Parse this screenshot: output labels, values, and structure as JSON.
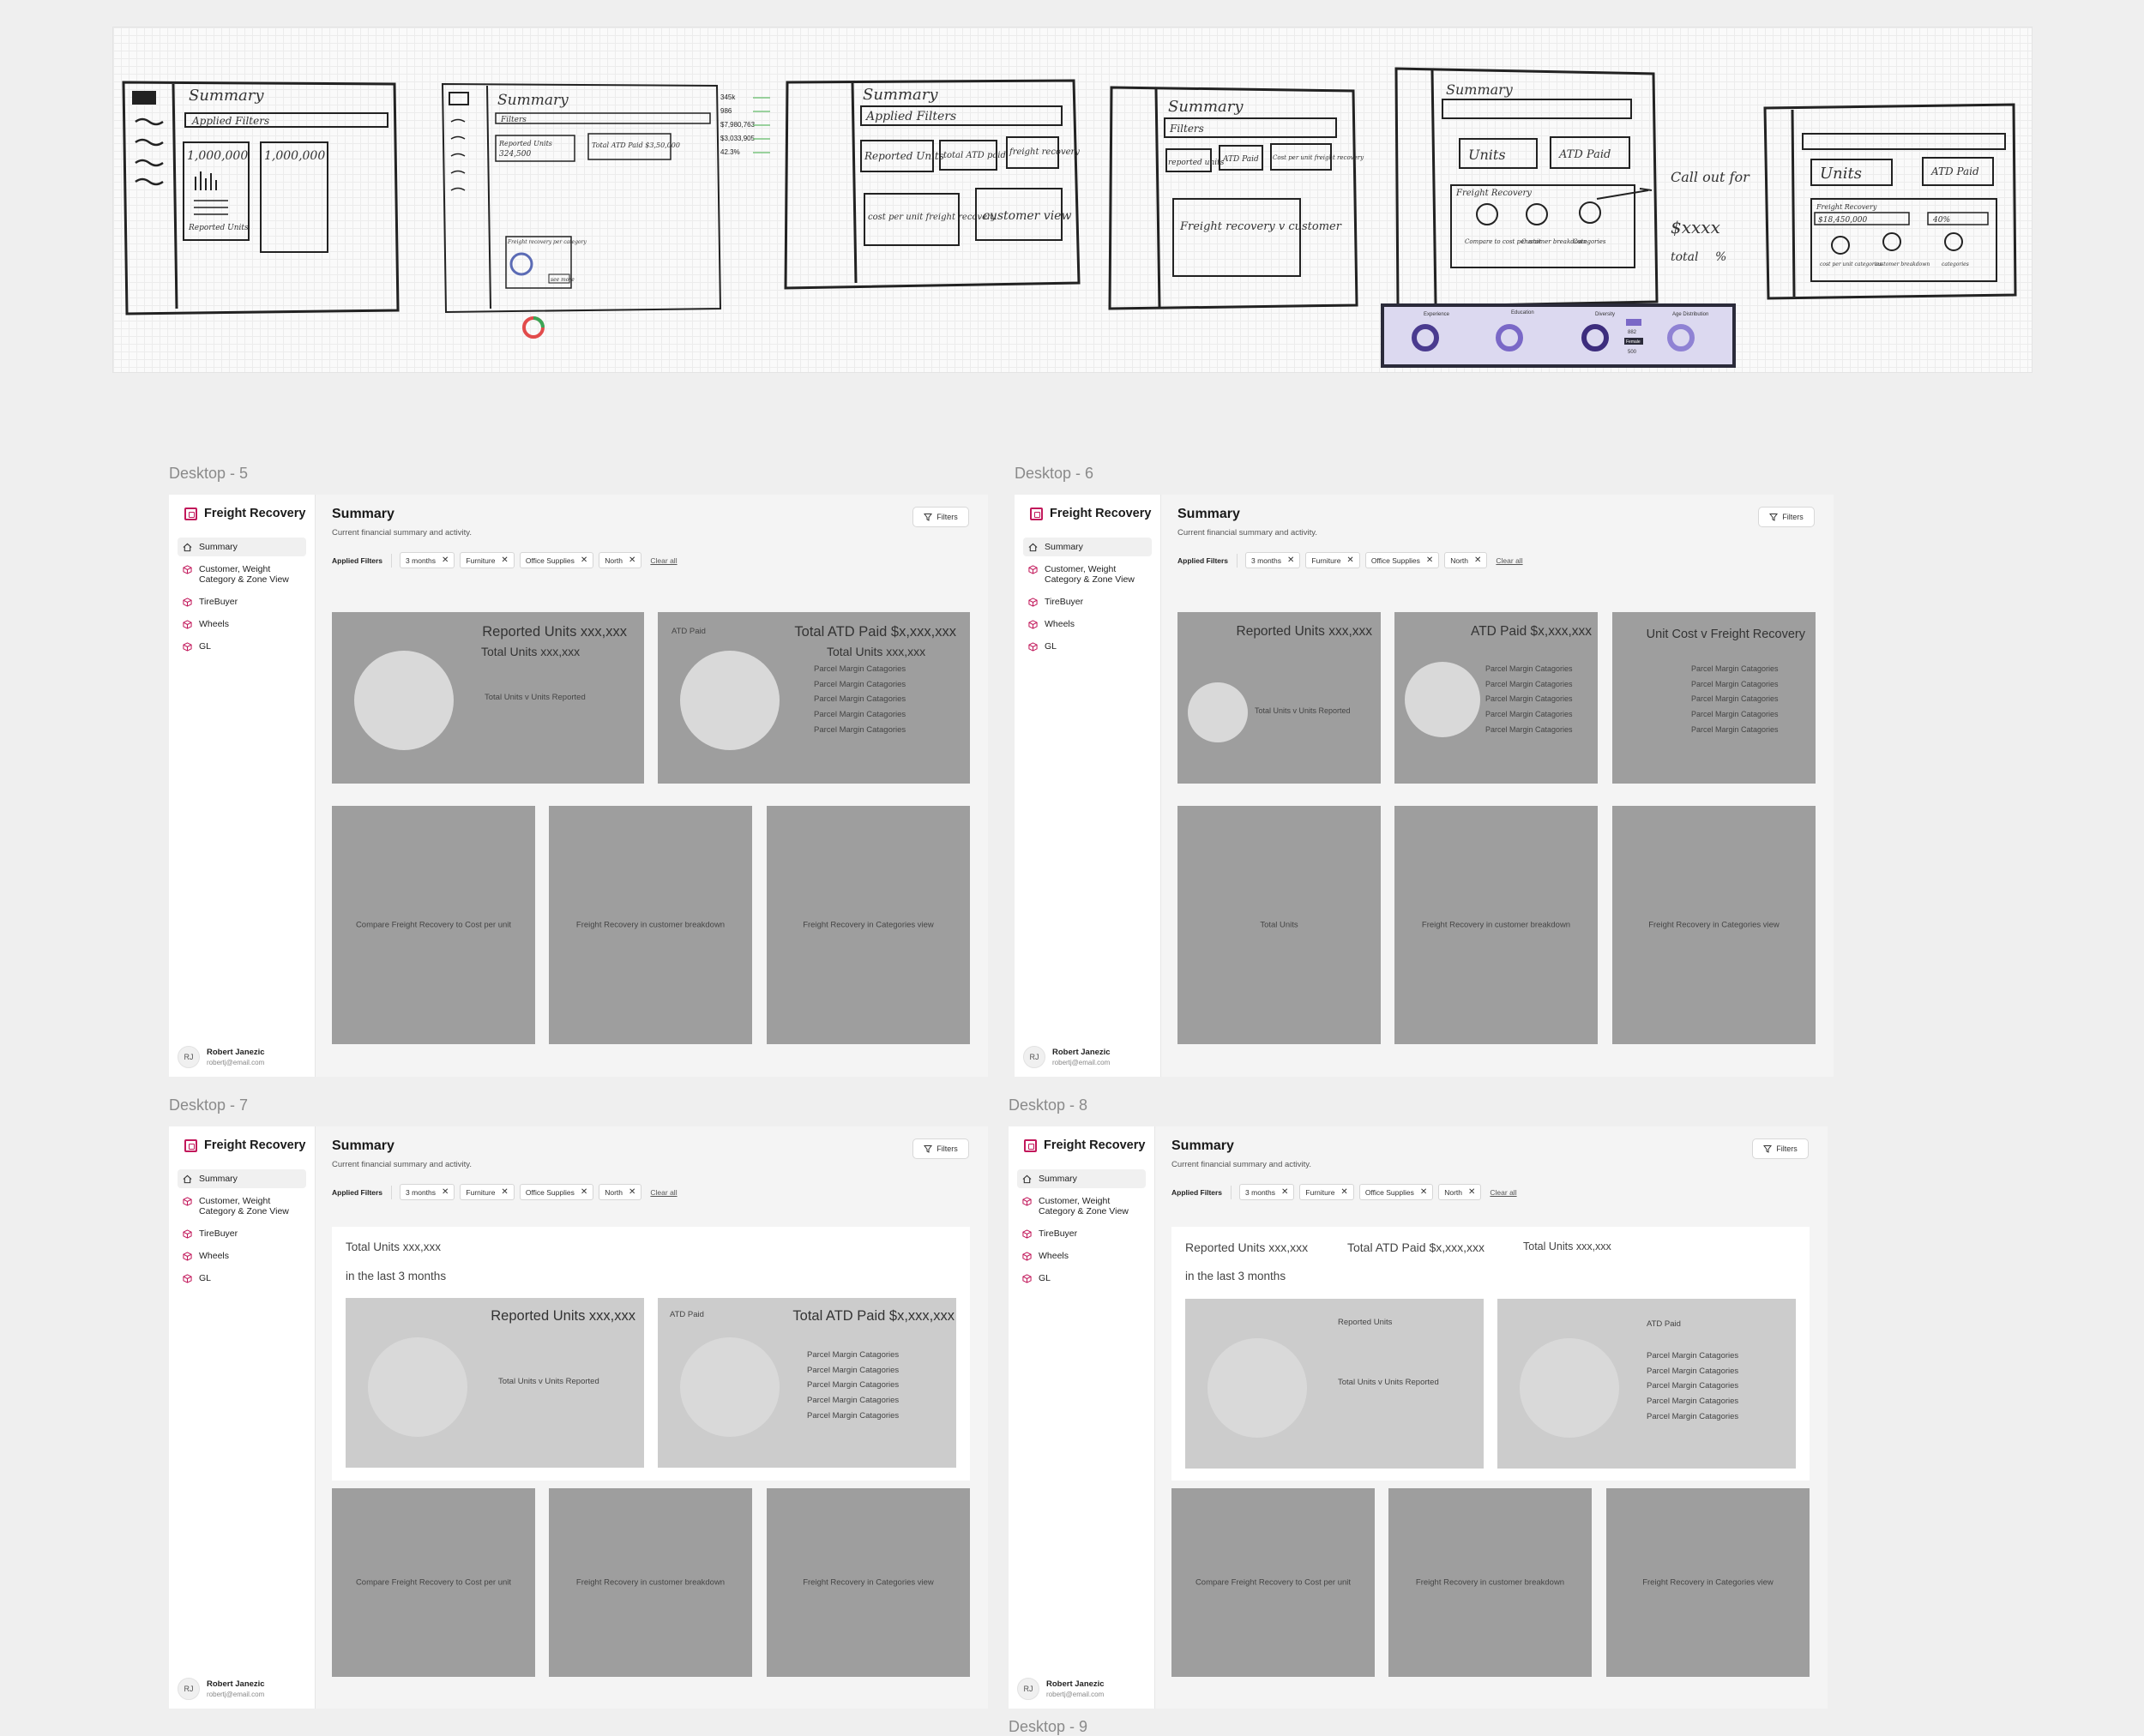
{
  "sketches": {
    "s1": {
      "title": "Summary",
      "filters": "Applied Filters",
      "n1": "1,000,000",
      "n2": "1,000,000",
      "caption": "Reported Units"
    },
    "s2": {
      "title": "Summary",
      "filters": "Filters",
      "box1a": "Reported Units",
      "box1b": "324,500",
      "box2": "Total ATD Paid $3,50,000",
      "note": "Freight recovery per category",
      "btn": "see more"
    },
    "s2side": {
      "v1": "345k",
      "v2": "986",
      "v3": "$7,980,763",
      "v4": "$3,033,905",
      "v5": "42.3%"
    },
    "s3": {
      "title": "Summary",
      "filters": "Applied Filters",
      "a": "Reported Units",
      "b": "total ATD paid",
      "c": "freight recovery",
      "d": "cost per unit freight recovery",
      "e": "customer view"
    },
    "s4": {
      "title": "Summary",
      "filters": "Filters",
      "a": "reported units",
      "b": "ATD Paid",
      "c": "Cost per unit freight recovery",
      "d": "Freight recovery v customer"
    },
    "s5": {
      "title": "Summary",
      "a": "Units",
      "b": "ATD Paid",
      "c": "Freight Recovery",
      "d": "Compare to cost per unit",
      "e": "Customer breakdown",
      "f": "Categories",
      "g": "Call out for",
      "h": "$xxxx",
      "i": "total",
      "j": "%"
    },
    "s6": {
      "a": "Units",
      "b": "ATD Paid",
      "c": "Freight Recovery",
      "d": "$18,450,000",
      "e": "40%",
      "f": "cost per unit categories",
      "g": "customer breakdown",
      "h": "categories"
    },
    "ref": {
      "t1": "Experience",
      "t2": "Education",
      "t3": "Diversity",
      "t4": "Age Distribution",
      "v1": "882",
      "v2": "Female",
      "v3": "500"
    }
  },
  "sidebar": {
    "brand": "Freight Recovery",
    "items": [
      {
        "label": "Summary",
        "icon": "home-icon"
      },
      {
        "label": "Customer, Weight Category & Zone View",
        "icon": "box-icon"
      },
      {
        "label": "TireBuyer",
        "icon": "box-icon"
      },
      {
        "label": "Wheels",
        "icon": "box-icon"
      },
      {
        "label": "GL",
        "icon": "box-icon"
      }
    ],
    "user": {
      "initials": "RJ",
      "name": "Robert Janezic",
      "email": "robertj@email.com"
    }
  },
  "header": {
    "title": "Summary",
    "subtitle": "Current financial summary and activity.",
    "filters_button": "Filters",
    "applied_label": "Applied Filters",
    "chips": [
      "3 months",
      "Furniture",
      "Office Supplies",
      "North"
    ],
    "clear": "Clear all"
  },
  "desktop5": {
    "label": "Desktop - 5",
    "c1": {
      "t1": "Reported Units xxx,xxx",
      "t2": "Total Units xxx,xxx",
      "t3": "Total Units v Units Reported"
    },
    "c2": {
      "t0": "ATD Paid",
      "t1": "Total ATD Paid $x,xxx,xxx",
      "t2": "Total Units xxx,xxx",
      "cats": [
        "Parcel Margin Catagories",
        "Parcel Margin Catagories",
        "Parcel Margin Catagories",
        "Parcel Margin Catagories",
        "Parcel Margin Catagories"
      ]
    },
    "b1": "Compare Freight Recovery to Cost per unit",
    "b2": "Freight Recovery in customer breakdown",
    "b3": "Freight Recovery in Categories view"
  },
  "desktop6": {
    "label": "Desktop - 6",
    "c1": {
      "t1": "Reported Units xxx,xxx",
      "t2": "Total Units v Units Reported"
    },
    "c2": {
      "t1": "ATD Paid $x,xxx,xxx",
      "cats": [
        "Parcel Margin Catagories",
        "Parcel Margin Catagories",
        "Parcel Margin Catagories",
        "Parcel Margin Catagories",
        "Parcel Margin Catagories"
      ]
    },
    "c3": {
      "t1": "Unit Cost v Freight Recovery",
      "cats": [
        "Parcel Margin Catagories",
        "Parcel Margin Catagories",
        "Parcel Margin Catagories",
        "Parcel Margin Catagories",
        "Parcel Margin Catagories"
      ]
    },
    "b1": "Total Units",
    "b2": "Freight Recovery in customer breakdown",
    "b3": "Freight Recovery in Categories view"
  },
  "desktop7": {
    "label": "Desktop - 7",
    "p1": "Total Units xxx,xxx",
    "p2": "in the last 3 months",
    "c1": {
      "t1": "Reported Units xxx,xxx",
      "t2": "Total Units v Units Reported"
    },
    "c2": {
      "t0": "ATD Paid",
      "t1": "Total ATD Paid $x,xxx,xxx",
      "cats": [
        "Parcel Margin Catagories",
        "Parcel Margin Catagories",
        "Parcel Margin Catagories",
        "Parcel Margin Catagories",
        "Parcel Margin Catagories"
      ]
    },
    "b1": "Compare Freight Recovery to Cost per unit",
    "b2": "Freight Recovery in customer breakdown",
    "b3": "Freight Recovery in Categories view"
  },
  "desktop8": {
    "label": "Desktop - 8",
    "h1": "Reported Units xxx,xxx",
    "h2": "Total ATD Paid $x,xxx,xxx",
    "h3": "Total Units xxx,xxx",
    "p2": "in the last 3 months",
    "c1": {
      "t1": "Reported Units",
      "t2": "Total Units v Units Reported"
    },
    "c2": {
      "t1": "ATD Paid",
      "cats": [
        "Parcel Margin Catagories",
        "Parcel Margin Catagories",
        "Parcel Margin Catagories",
        "Parcel Margin Catagories",
        "Parcel Margin Catagories"
      ]
    },
    "b1": "Compare Freight Recovery to Cost per unit",
    "b2": "Freight Recovery in customer breakdown",
    "b3": "Freight Recovery in Categories view"
  },
  "peek_label": "Desktop - 9"
}
